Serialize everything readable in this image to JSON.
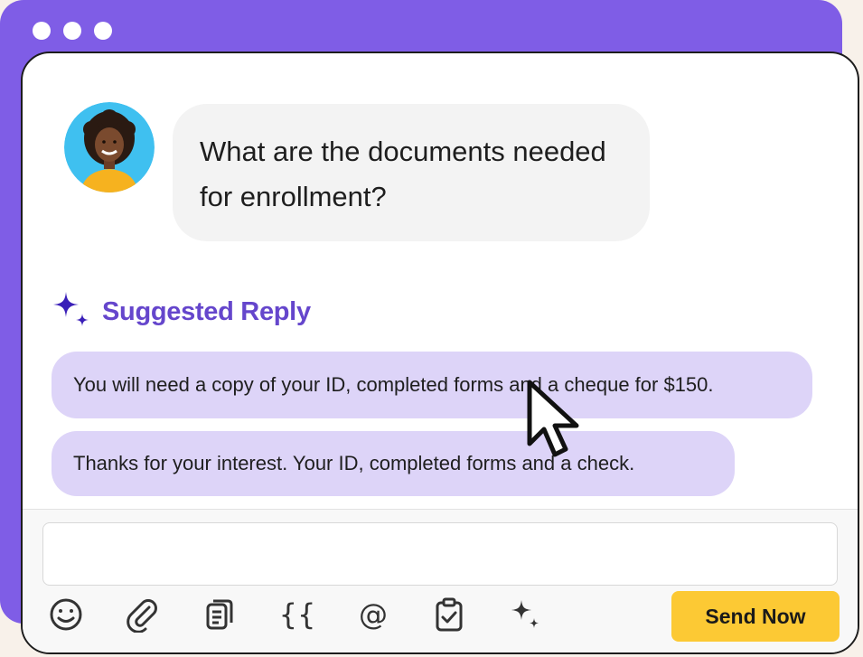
{
  "window": {
    "dots": 3
  },
  "message": {
    "avatar_icon": "user-avatar-photo",
    "text": "What are the documents needed for enrollment?"
  },
  "suggestions": {
    "title": "Suggested Reply",
    "icon": "sparkle-icon",
    "items": [
      {
        "label": "You will need a copy of your ID, completed forms and a cheque for $150."
      },
      {
        "label": "Thanks for your interest. Your ID, completed forms and a check."
      }
    ]
  },
  "composer": {
    "value": "",
    "placeholder": "",
    "tools": [
      {
        "name": "emoji-icon"
      },
      {
        "name": "paperclip-icon"
      },
      {
        "name": "document-icon"
      },
      {
        "name": "variables-icon",
        "glyph": "{{"
      },
      {
        "name": "mention-icon",
        "glyph": "@"
      },
      {
        "name": "clipboard-check-icon"
      },
      {
        "name": "sparkle-icon"
      }
    ],
    "send_label": "Send Now"
  },
  "colors": {
    "frame": "#7f5de6",
    "accent": "#6546cc",
    "chip": "#ddd4f8",
    "send": "#fcc934",
    "bubble": "#f3f3f3"
  }
}
